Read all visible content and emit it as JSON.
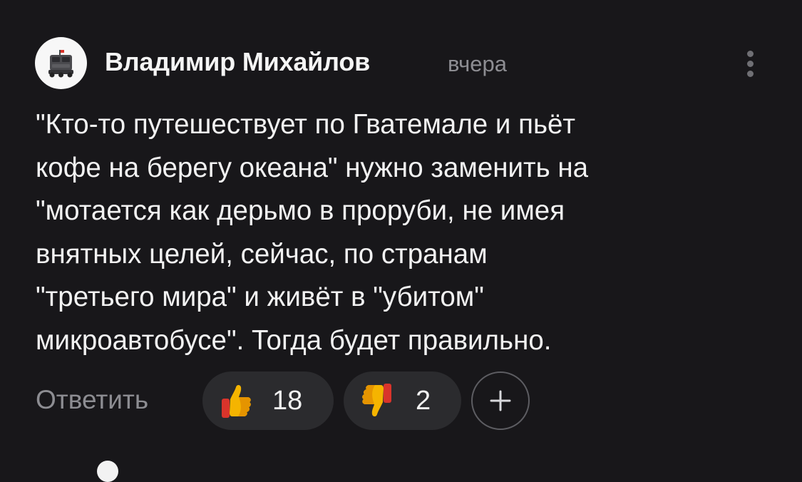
{
  "comment": {
    "author": "Владимир Михайлов",
    "time": "вчера",
    "lines": [
      "\"Кто-то путешествует по Гватемале и пьёт",
      "кофе на берегу океана\" нужно заменить на",
      "\"мотается как дерьмо в проруби, не имея",
      "внятных целей, сейчас, по странам",
      "\"третьего мира\" и живёт в \"убитом\"",
      "микроавтобусе\". Тогда будет правильно."
    ]
  },
  "actions": {
    "reply_label": "Ответить",
    "reactions": [
      {
        "icon": "thumbs-up-emoji",
        "count": "18"
      },
      {
        "icon": "thumbs-down-emoji",
        "count": "2"
      }
    ],
    "add_reaction_icon": "plus-icon"
  },
  "colors": {
    "background": "#18171a",
    "text": "#f2f2f2",
    "muted": "#8d8d92",
    "pill": "#2b2b2e",
    "emoji_yellow": "#f5b400"
  }
}
